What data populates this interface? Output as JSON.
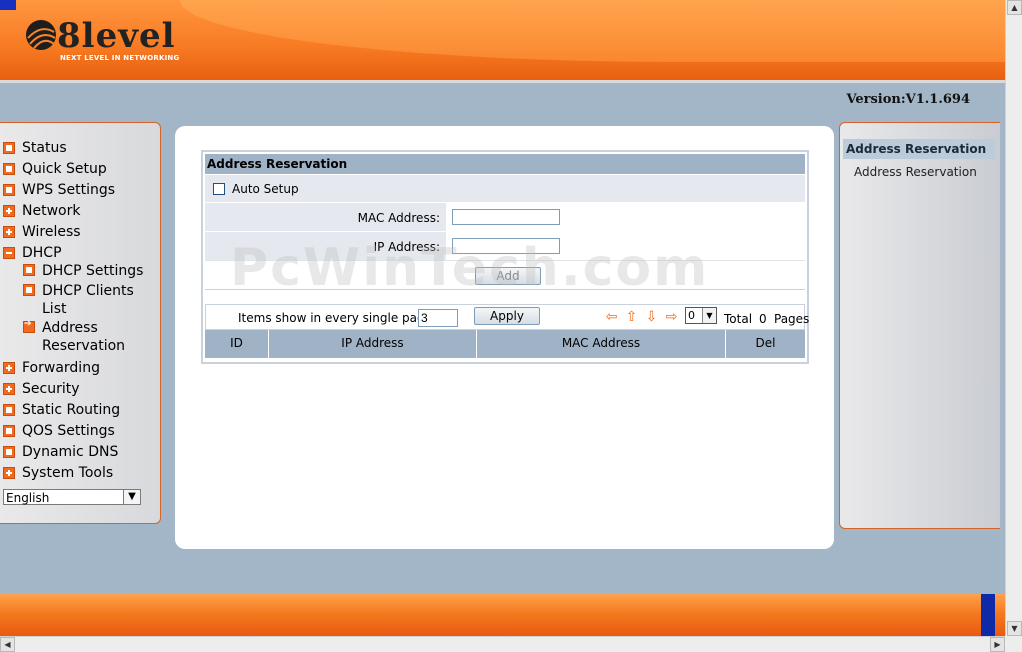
{
  "brand": {
    "name": "8level",
    "tagline": "NEXT LEVEL IN NETWORKING"
  },
  "version": "Version:V1.1.694",
  "menu": {
    "items": [
      {
        "label": "Status",
        "icon": "box"
      },
      {
        "label": "Quick Setup",
        "icon": "box"
      },
      {
        "label": "WPS Settings",
        "icon": "box"
      },
      {
        "label": "Network",
        "icon": "plus"
      },
      {
        "label": "Wireless",
        "icon": "plus"
      },
      {
        "label": "DHCP",
        "icon": "minus"
      },
      {
        "label": "Forwarding",
        "icon": "plus"
      },
      {
        "label": "Security",
        "icon": "plus"
      },
      {
        "label": "Static Routing",
        "icon": "box"
      },
      {
        "label": "QOS Settings",
        "icon": "box"
      },
      {
        "label": "Dynamic DNS",
        "icon": "box"
      },
      {
        "label": "System Tools",
        "icon": "plus"
      }
    ],
    "dhcp_sub": {
      "settings": "DHCP Settings",
      "clients_1": "DHCP Clients",
      "clients_2": "List",
      "reservation_1": "Address",
      "reservation_2": "Reservation"
    },
    "language": "English"
  },
  "form": {
    "title": "Address Reservation",
    "auto_setup_label": "Auto Setup",
    "auto_setup_checked": false,
    "mac_label": "MAC Address:",
    "mac_value": "",
    "ip_label": "IP Address:",
    "ip_value": "",
    "add_label": "Add",
    "items_label": "Items show in every single page",
    "items_value": "3",
    "apply_label": "Apply",
    "page_select": "0",
    "total_label": "Total",
    "total_value": "0",
    "pages_label": "Pages",
    "columns": [
      "ID",
      "IP Address",
      "MAC Address",
      "Del"
    ]
  },
  "help": {
    "title": "Address Reservation",
    "link": "Address Reservation"
  },
  "watermark": "PcWinTech.com",
  "colors": {
    "accent": "#f06a20",
    "panel_header": "#a0b2c6",
    "background": "#a3b6c7"
  }
}
